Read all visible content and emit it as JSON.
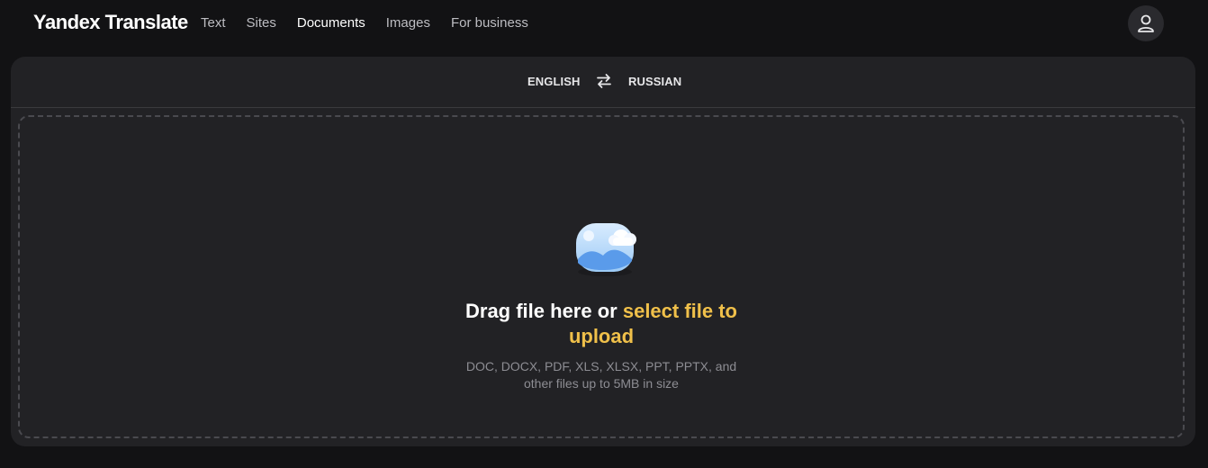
{
  "brand": "Yandex Translate",
  "nav": {
    "items": [
      {
        "label": "Text"
      },
      {
        "label": "Sites"
      },
      {
        "label": "Documents",
        "active": true
      },
      {
        "label": "Images"
      },
      {
        "label": "For business"
      }
    ]
  },
  "user": {
    "icon": "user-icon"
  },
  "languages": {
    "source": "ENGLISH",
    "target": "RUSSIAN",
    "swap_icon": "swap-arrows-icon"
  },
  "upload": {
    "illustration_icon": "image-cloud-icon",
    "prompt_prefix": "Drag file here or ",
    "prompt_link_line1": "select file to",
    "prompt_link_line2": "upload",
    "formats_line1": "DOC, DOCX, PDF, XLS, XLSX, PPT, PPTX, and",
    "formats_line2": "other files up to 5MB in size"
  },
  "colors": {
    "background": "#121214",
    "card": "#222225",
    "accent_link": "#f0c04a"
  }
}
